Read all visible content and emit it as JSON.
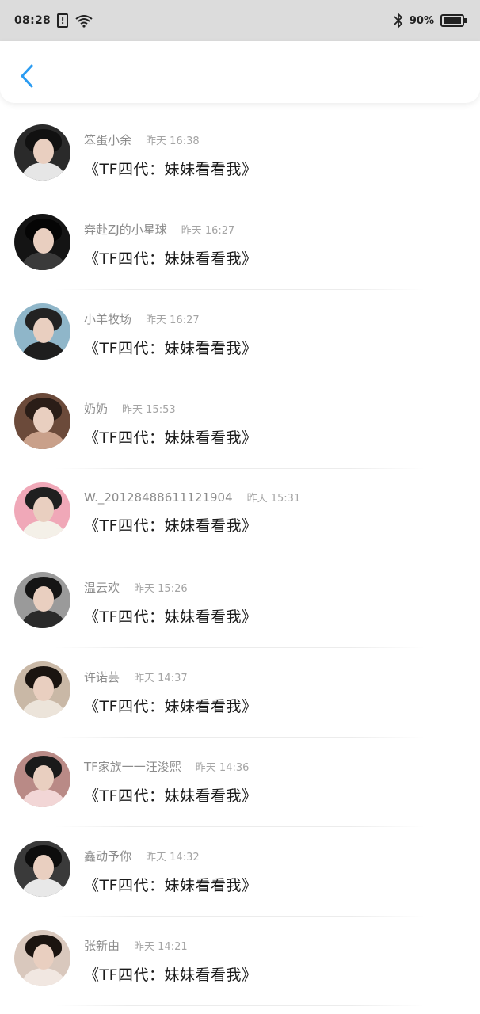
{
  "status_bar": {
    "time": "08:28",
    "alert_glyph": "!",
    "battery_pct": "90%",
    "icons": [
      "sim-alert-icon",
      "wifi-icon",
      "bluetooth-icon",
      "battery-icon"
    ]
  },
  "header": {
    "back_icon": "chevron-left-icon",
    "accent_color": "#2b9cf2"
  },
  "messages": [
    {
      "username": "笨蛋小余",
      "time": "昨天 16:38",
      "text": "《TF四代：妹妹看看我》",
      "avatar_bg": "#2a2a2a",
      "avatar_hair": "#111111",
      "avatar_body": "#e6e6e6"
    },
    {
      "username": "奔赴ZJ的小星球",
      "time": "昨天 16:27",
      "text": "《TF四代：妹妹看看我》",
      "avatar_bg": "#141414",
      "avatar_hair": "#050505",
      "avatar_body": "#3a3a3a"
    },
    {
      "username": "小羊牧场",
      "time": "昨天 16:27",
      "text": "《TF四代：妹妹看看我》",
      "avatar_bg": "#8fb6c9",
      "avatar_hair": "#222222",
      "avatar_body": "#1e1e1e"
    },
    {
      "username": "奶奶",
      "time": "昨天 15:53",
      "text": "《TF四代：妹妹看看我》",
      "avatar_bg": "#6b4a3a",
      "avatar_hair": "#2a1d17",
      "avatar_body": "#c9a08a"
    },
    {
      "username": "W._20128488611121904",
      "time": "昨天 15:31",
      "text": "《TF四代：妹妹看看我》",
      "avatar_bg": "#f0a8b8",
      "avatar_hair": "#1f1f1f",
      "avatar_body": "#f4f0e8"
    },
    {
      "username": "温云欢",
      "time": "昨天 15:26",
      "text": "《TF四代：妹妹看看我》",
      "avatar_bg": "#9a9a9a",
      "avatar_hair": "#151515",
      "avatar_body": "#2a2a2a"
    },
    {
      "username": "许诺芸",
      "time": "昨天 14:37",
      "text": "《TF四代：妹妹看看我》",
      "avatar_bg": "#c9b8a6",
      "avatar_hair": "#1a1410",
      "avatar_body": "#ece4da"
    },
    {
      "username": "TF家族一一汪浚熙",
      "time": "昨天 14:36",
      "text": "《TF四代：妹妹看看我》",
      "avatar_bg": "#b98a86",
      "avatar_hair": "#1a1a1a",
      "avatar_body": "#f2d6d6"
    },
    {
      "username": "鑫动予你",
      "time": "昨天 14:32",
      "text": "《TF四代：妹妹看看我》",
      "avatar_bg": "#3a3a3a",
      "avatar_hair": "#0d0d0d",
      "avatar_body": "#e8e8e8"
    },
    {
      "username": "张新由",
      "time": "昨天 14:21",
      "text": "《TF四代：妹妹看看我》",
      "avatar_bg": "#d9c8bd",
      "avatar_hair": "#1b1410",
      "avatar_body": "#f1e7e1"
    }
  ]
}
